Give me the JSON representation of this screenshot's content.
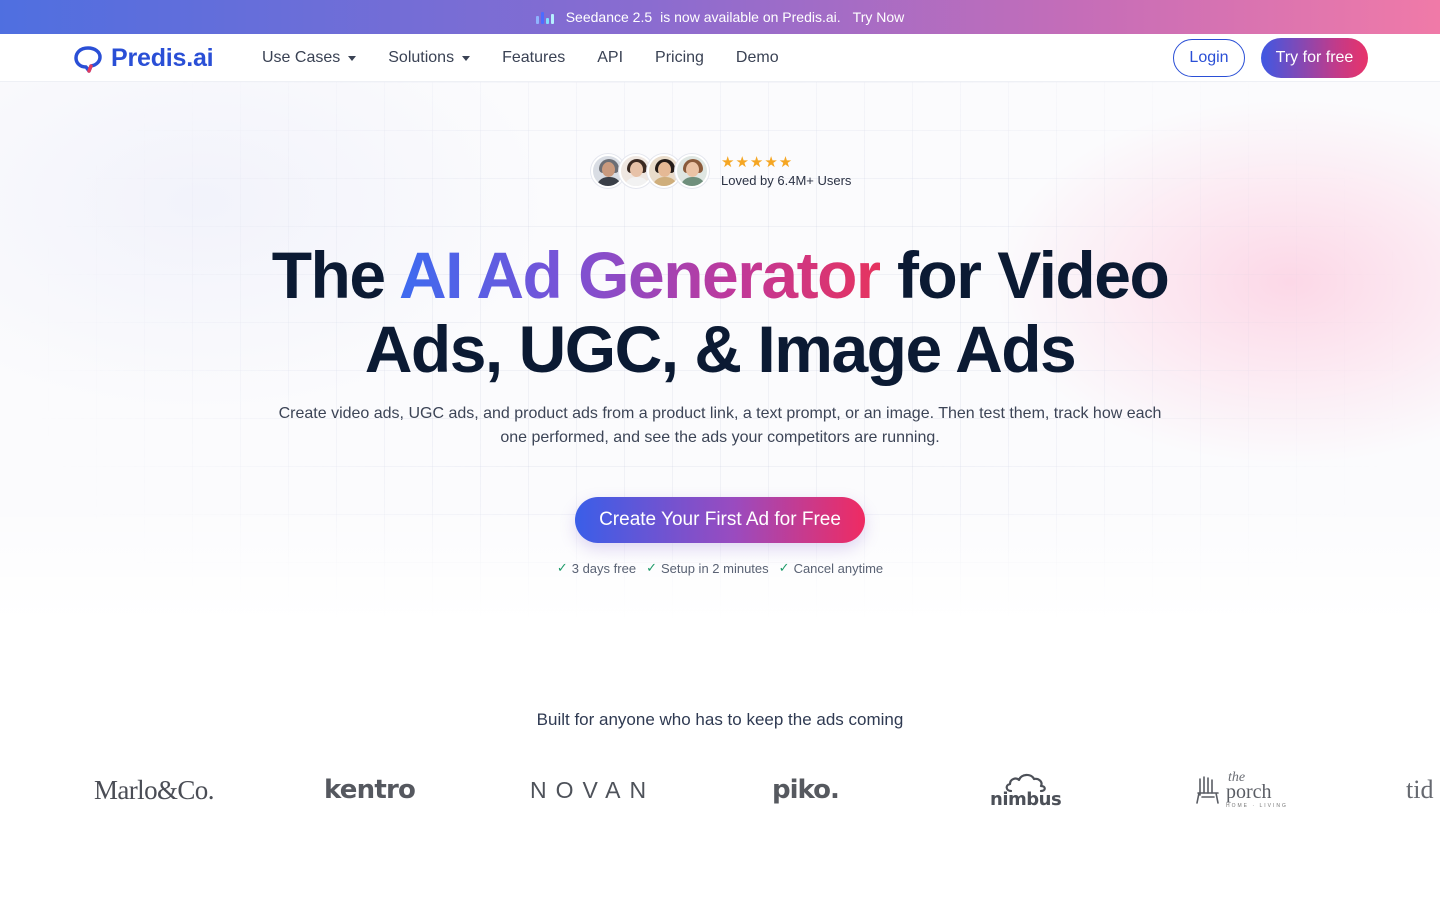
{
  "announcement": {
    "product": "Seedance 2.5",
    "message": "is now available on Predis.ai.",
    "cta": "Try Now"
  },
  "nav": {
    "logo_text": "Predis.ai",
    "items": [
      {
        "label": "Use Cases",
        "dropdown": true
      },
      {
        "label": "Solutions",
        "dropdown": true
      },
      {
        "label": "Features",
        "dropdown": false
      },
      {
        "label": "API",
        "dropdown": false
      },
      {
        "label": "Pricing",
        "dropdown": false
      },
      {
        "label": "Demo",
        "dropdown": false
      }
    ],
    "login_label": "Login",
    "try_label": "Try for free"
  },
  "hero": {
    "rating_stars": "★★★★★",
    "social_proof": "Loved by 6.4M+ Users",
    "headline_part1": "The ",
    "headline_highlight": "AI Ad Generator",
    "headline_part2": " for Video",
    "headline_line2": "Ads, UGC, & Image Ads",
    "subheadline": "Create video ads, UGC ads, and product ads from a product link, a text prompt, or an image. Then test them, track how each one performed, and see the ads your competitors are running.",
    "cta_label": "Create Your First Ad for Free",
    "checks": [
      "3 days free",
      "Setup in 2 minutes",
      "Cancel anytime"
    ]
  },
  "logos_section": {
    "heading": "Built for anyone who has to keep the ads coming",
    "brands": {
      "marlo": "Marlo&Co.",
      "kentro": "kentro",
      "novan": "NOVAN",
      "piko": "piko.",
      "nimbus": "nimbus",
      "porch_the": "the",
      "porch_word": "porch",
      "porch_tag": "HOME · LIVING",
      "tid": "tid"
    }
  },
  "colors": {
    "brand_blue": "#2a4fd6",
    "headline_dark": "#0b1a33",
    "star": "#f5a623",
    "check_green": "#1f9b6a"
  }
}
